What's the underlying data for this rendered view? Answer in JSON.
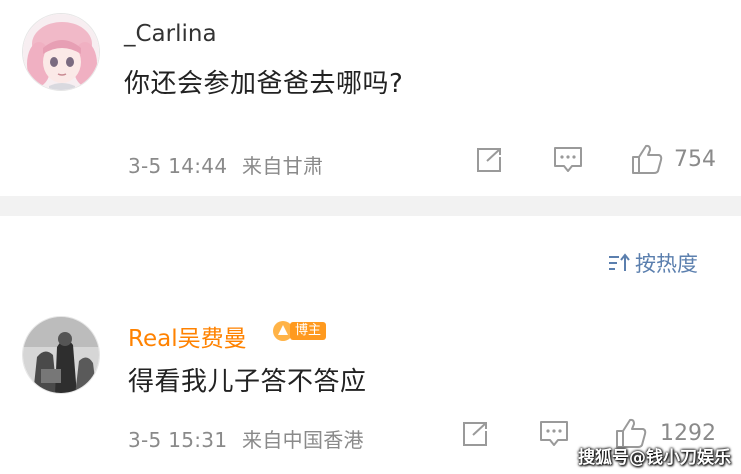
{
  "comments": [
    {
      "username": "_Carlina",
      "text": "你还会参加爸爸去哪吗?",
      "timestamp": "3-5 14:44",
      "location": "来自甘肃",
      "like_count": "754"
    },
    {
      "username": "Real吴费曼",
      "badge": "博主",
      "text": "得看我儿子答不答应",
      "timestamp": "3-5 15:31",
      "location": "来自中国香港",
      "like_count": "1292"
    }
  ],
  "sort_toggle": {
    "label": "按热度"
  },
  "watermark": "搜狐号@钱小刀娱乐",
  "colors": {
    "username_default": "#333333",
    "username_author": "#ff8200",
    "meta_text": "#8a8a8a",
    "sort_link": "#5b7fae",
    "divider_band": "#f2f2f2",
    "badge": "#ff9a1f"
  },
  "icons": {
    "share": "share-icon",
    "comment": "comment-icon",
    "like": "thumbs-up-icon",
    "sort": "sort-icon"
  }
}
